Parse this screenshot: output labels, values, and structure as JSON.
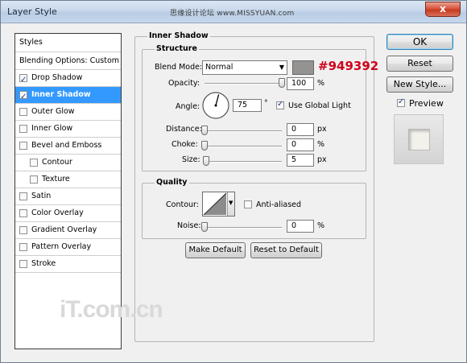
{
  "window": {
    "title": "Layer Style",
    "close_glyph": "x",
    "watermark_top": "思缘设计论坛 www.MISSYUAN.com"
  },
  "styles_panel": {
    "header": "Styles",
    "blending": "Blending Options: Custom",
    "items": [
      {
        "label": "Drop Shadow",
        "checked": true,
        "selected": false
      },
      {
        "label": "Inner Shadow",
        "checked": true,
        "selected": true
      },
      {
        "label": "Outer Glow",
        "checked": false,
        "selected": false
      },
      {
        "label": "Inner Glow",
        "checked": false,
        "selected": false
      },
      {
        "label": "Bevel and Emboss",
        "checked": false,
        "selected": false
      },
      {
        "label": "Contour",
        "checked": false,
        "selected": false
      },
      {
        "label": "Texture",
        "checked": false,
        "selected": false
      },
      {
        "label": "Satin",
        "checked": false,
        "selected": false
      },
      {
        "label": "Color Overlay",
        "checked": false,
        "selected": false
      },
      {
        "label": "Gradient Overlay",
        "checked": false,
        "selected": false
      },
      {
        "label": "Pattern Overlay",
        "checked": false,
        "selected": false
      },
      {
        "label": "Stroke",
        "checked": false,
        "selected": false
      }
    ]
  },
  "inner_shadow": {
    "section_title": "Inner Shadow",
    "structure_title": "Structure",
    "blend_mode_label": "Blend Mode:",
    "blend_mode_value": "Normal",
    "shadow_color": "#949392",
    "color_annotation": "#949392",
    "opacity_label": "Opacity:",
    "opacity_value": "100",
    "opacity_unit": "%",
    "opacity_fraction": 1.0,
    "angle_label": "Angle:",
    "angle_value": "75",
    "angle_unit": "°",
    "use_global_light_label": "Use Global Light",
    "use_global_light_checked": true,
    "distance_label": "Distance:",
    "distance_value": "0",
    "distance_unit": "px",
    "distance_fraction": 0.0,
    "choke_label": "Choke:",
    "choke_value": "0",
    "choke_unit": "%",
    "choke_fraction": 0.0,
    "size_label": "Size:",
    "size_value": "5",
    "size_unit": "px",
    "size_fraction": 0.02
  },
  "quality": {
    "title": "Quality",
    "contour_label": "Contour:",
    "anti_aliased_label": "Anti-aliased",
    "anti_aliased_checked": false,
    "noise_label": "Noise:",
    "noise_value": "0",
    "noise_unit": "%",
    "noise_fraction": 0.0
  },
  "buttons": {
    "make_default": "Make Default",
    "reset_default": "Reset to Default",
    "ok": "OK",
    "reset": "Reset",
    "new_style": "New Style...",
    "preview_label": "Preview",
    "preview_checked": true
  },
  "watermark_bottom": "iT.com.cn"
}
